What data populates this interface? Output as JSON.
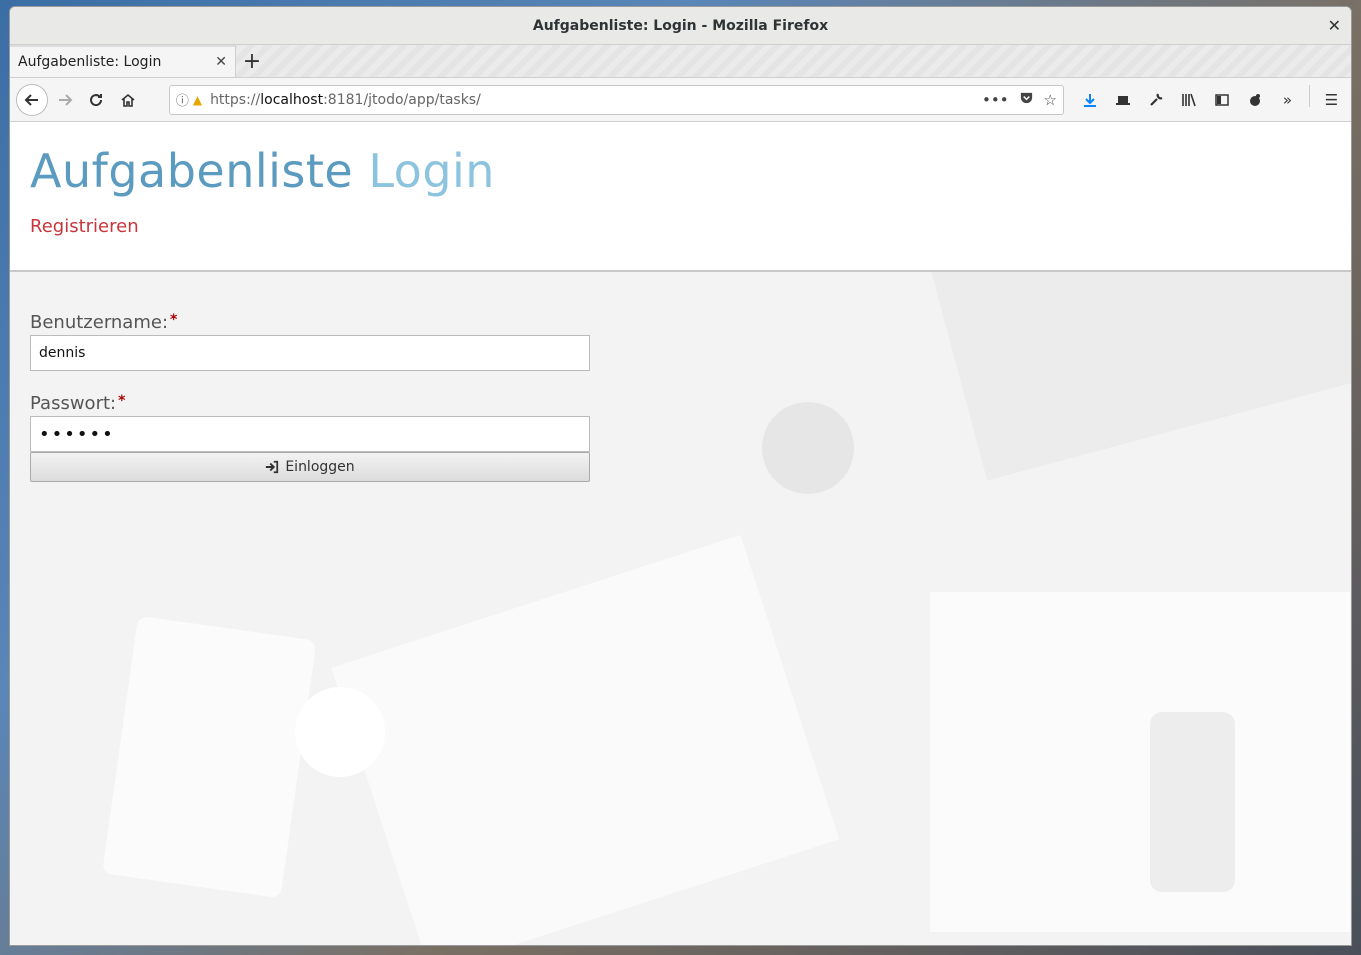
{
  "window": {
    "title": "Aufgabenliste: Login - Mozilla Firefox",
    "close": "✕"
  },
  "tabs": [
    {
      "label": "Aufgabenliste: Login",
      "close": "✕"
    }
  ],
  "newtab": "+",
  "urlbar": {
    "scheme": "https://",
    "host": "localhost",
    "rest": ":8181/jtodo/app/tasks/"
  },
  "page": {
    "title_main": "Aufgabenliste",
    "title_accent": "Login",
    "register_link": "Registrieren",
    "username_label": "Benutzername:",
    "username_value": "dennis",
    "password_label": "Passwort:",
    "password_value": "••••••",
    "required_mark": "*",
    "login_button": "Einloggen"
  },
  "colors": {
    "title": "#5b9bbf",
    "title_accent": "#8cc3de",
    "link": "#c9353b",
    "required": "#aa0000"
  }
}
